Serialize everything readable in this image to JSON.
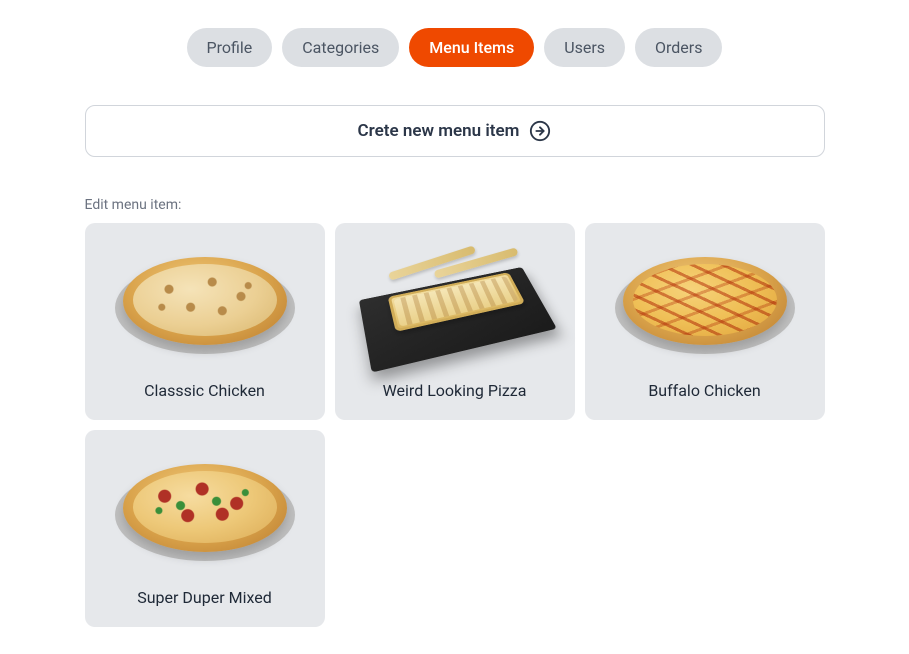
{
  "tabs": [
    {
      "label": "Profile",
      "active": false
    },
    {
      "label": "Categories",
      "active": false
    },
    {
      "label": "Menu Items",
      "active": true
    },
    {
      "label": "Users",
      "active": false
    },
    {
      "label": "Orders",
      "active": false
    }
  ],
  "actions": {
    "create_label": "Crete new menu item"
  },
  "list": {
    "heading": "Edit menu item:",
    "items": [
      {
        "name": "Classsic Chicken",
        "style": "classic"
      },
      {
        "name": "Weird Looking Pizza",
        "style": "weird"
      },
      {
        "name": "Buffalo Chicken",
        "style": "buffalo"
      },
      {
        "name": "Super Duper Mixed",
        "style": "mixed"
      }
    ]
  },
  "colors": {
    "accent": "#ef4900"
  }
}
